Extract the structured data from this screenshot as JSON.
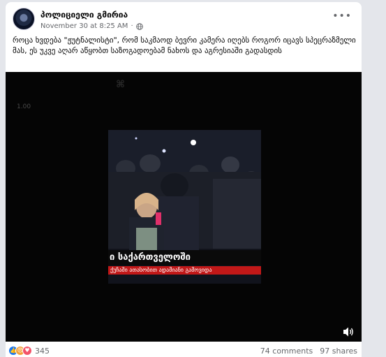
{
  "post": {
    "author": "პოლიციელი გმირია",
    "timestamp": "November 30 at 8:25 AM",
    "privacy_icon": "globe-icon",
    "more_icon": "more-options-icon",
    "text": "როცა ხვდება \"ჟუტნალისტი\", რომ საკმაოდ ბევრი კამერა იღებს როგორ იცავს სპეცრაზმელი მას, ეს უკვე აღარ აწყობთ საზოგადოებამ ნახოს და აგრესიაში გადასდის"
  },
  "video": {
    "watermark": "⌘",
    "speed": "1.00",
    "banner_text": "ი საქართველოში",
    "ticker_text": "ქუჩაში ათასობით ადამიანი გამოვიდა",
    "mute_icon": "speaker-icon"
  },
  "footer": {
    "reactions": [
      "like",
      "angry",
      "care"
    ],
    "reaction_count": "345",
    "comments": "74 comments",
    "shares": "97 shares"
  }
}
